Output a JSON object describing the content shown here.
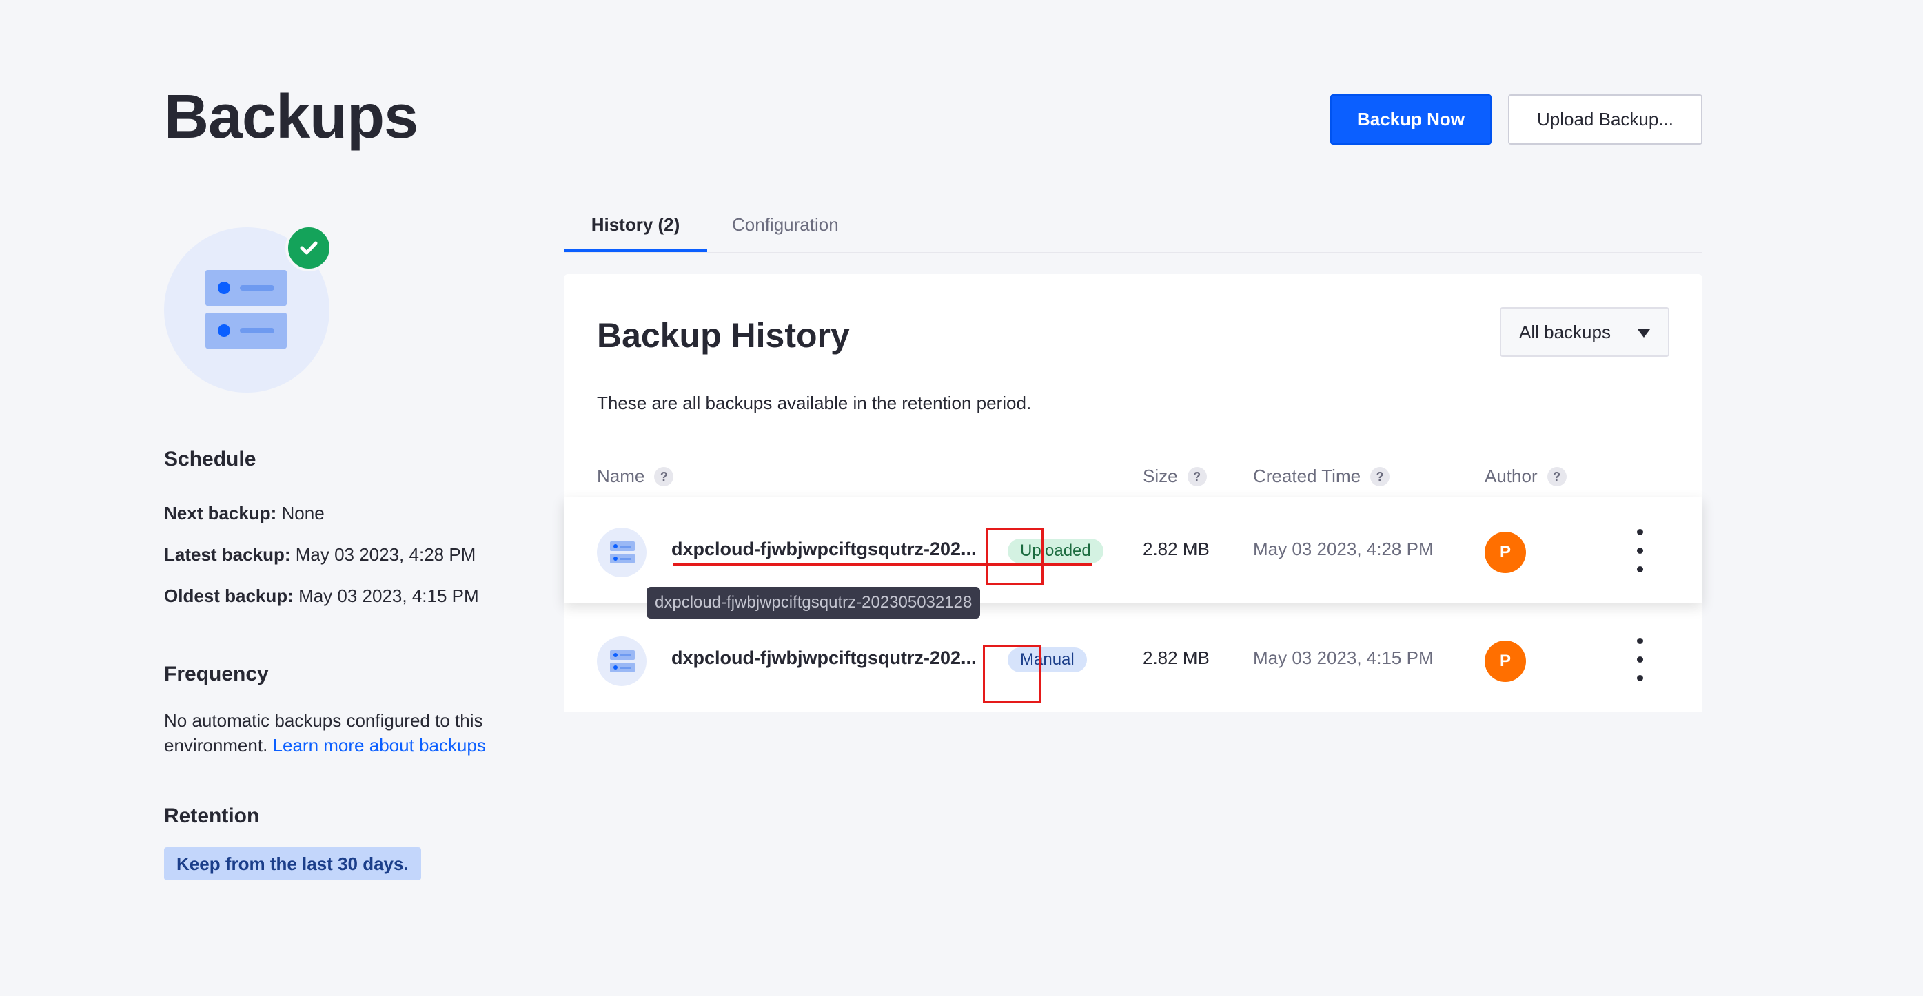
{
  "page": {
    "title": "Backups"
  },
  "actions": {
    "backup_now": "Backup Now",
    "upload_backup": "Upload Backup..."
  },
  "sidebar": {
    "schedule": {
      "heading": "Schedule",
      "next_label": "Next backup:",
      "next_value": "None",
      "latest_label": "Latest backup:",
      "latest_value": "May 03 2023, 4:28 PM",
      "oldest_label": "Oldest backup:",
      "oldest_value": "May 03 2023, 4:15 PM"
    },
    "frequency": {
      "heading": "Frequency",
      "text": "No automatic backups configured to this environment.",
      "link": "Learn more about backups"
    },
    "retention": {
      "heading": "Retention",
      "badge": "Keep from the last 30 days."
    }
  },
  "tabs": [
    {
      "label": "History (2)",
      "active": true
    },
    {
      "label": "Configuration",
      "active": false
    }
  ],
  "history": {
    "title": "Backup History",
    "filter": "All backups",
    "description": "These are all backups available in the retention period.",
    "columns": [
      "Name",
      "Size",
      "Created Time",
      "Author"
    ],
    "help_glyph": "?",
    "rows": [
      {
        "name": "dxpcloud-fjwbjwpciftgsqutrz-202...",
        "status": "Uploaded",
        "size": "2.82 MB",
        "created": "May 03 2023, 4:28 PM",
        "author_initial": "P"
      },
      {
        "name": "dxpcloud-fjwbjwpciftgsqutrz-202...",
        "status": "Manual",
        "size": "2.82 MB",
        "created": "May 03 2023, 4:15 PM",
        "author_initial": "P"
      }
    ],
    "tooltip": "dxpcloud-fjwbjwpciftgsqutrz-202305032128"
  },
  "colors": {
    "primary": "#0b5fff",
    "success": "#14a35a",
    "avatar": "#ff6f00",
    "annotation": "#e51a1a"
  }
}
